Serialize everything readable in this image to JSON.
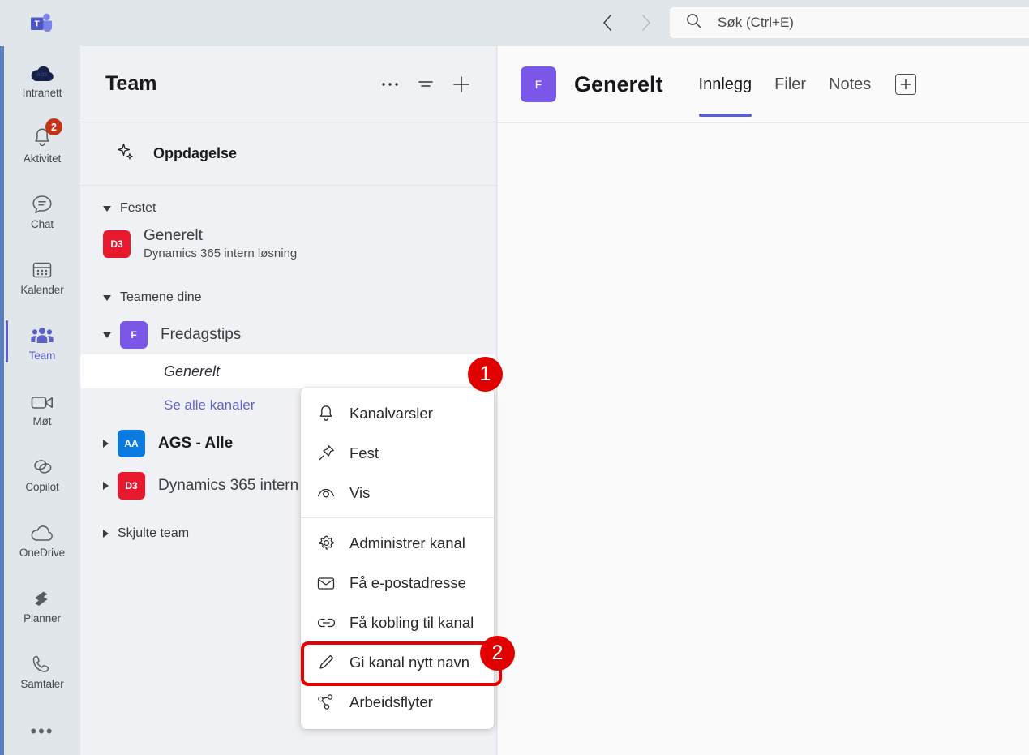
{
  "topbar": {
    "logo_name": "microsoft-teams-logo",
    "back_label": "‹",
    "forward_label": "›",
    "search_placeholder": "Søk (Ctrl+E)",
    "search_value": ""
  },
  "rail": {
    "items": [
      {
        "label": "Intranett",
        "icon": "cloud-ags-icon",
        "badge": "",
        "active": false
      },
      {
        "label": "Aktivitet",
        "icon": "bell-icon",
        "badge": "2",
        "active": false
      },
      {
        "label": "Chat",
        "icon": "chat-bubble-icon",
        "badge": "",
        "active": false
      },
      {
        "label": "Kalender",
        "icon": "calendar-icon",
        "badge": "",
        "active": false
      },
      {
        "label": "Team",
        "icon": "people-icon",
        "badge": "",
        "active": true
      },
      {
        "label": "Møt",
        "icon": "video-camera-icon",
        "badge": "",
        "active": false
      },
      {
        "label": "Copilot",
        "icon": "copilot-icon",
        "badge": "",
        "active": false
      },
      {
        "label": "OneDrive",
        "icon": "cloud-icon",
        "badge": "",
        "active": false
      },
      {
        "label": "Planner",
        "icon": "planner-icon",
        "badge": "",
        "active": false
      },
      {
        "label": "Samtaler",
        "icon": "phone-icon",
        "badge": "",
        "active": false
      }
    ],
    "more_label": "•••"
  },
  "teampanel": {
    "title": "Team",
    "header_icons": [
      "more-options-icon",
      "filter-icon",
      "add-icon"
    ],
    "discovery": {
      "label": "Oppdagelse",
      "icon": "sparkle-icon"
    },
    "pinned_group": {
      "label": "Festet",
      "items": [
        {
          "name": "Generelt",
          "subtitle": "Dynamics 365 intern løsning",
          "avatar_text": "D3",
          "avatar_color": "#e8192c"
        }
      ]
    },
    "teams_group": {
      "label": "Teamene dine",
      "expanded_team": {
        "name": "Fredagstips",
        "avatar_text": "F",
        "avatar_color": "#7b57e8",
        "channels": [
          {
            "name": "Generelt",
            "selected": true
          }
        ],
        "see_all_label": "Se alle kanaler"
      },
      "collapsed_teams": [
        {
          "name": "AGS - Alle",
          "avatar_text": "AA",
          "avatar_color": "#0a7ae0",
          "bold": true
        },
        {
          "name": "Dynamics 365 intern",
          "avatar_text": "D3",
          "avatar_color": "#e8192c",
          "bold": false
        }
      ]
    },
    "hidden_group": {
      "label": "Skjulte team"
    }
  },
  "main": {
    "avatar_text": "F",
    "avatar_color": "#7b57e8",
    "channel_title": "Generelt",
    "tabs": [
      {
        "label": "Innlegg",
        "active": true
      },
      {
        "label": "Filer",
        "active": false
      },
      {
        "label": "Notes",
        "active": false
      }
    ],
    "add_tab_icon": "add-tab-icon"
  },
  "context_menu": {
    "groups": [
      {
        "items": [
          {
            "label": "Kanalvarsler",
            "icon": "bell-icon"
          },
          {
            "label": "Fest",
            "icon": "pin-icon"
          },
          {
            "label": "Vis",
            "icon": "eye-icon"
          }
        ]
      },
      {
        "items": [
          {
            "label": "Administrer kanal",
            "icon": "gear-icon"
          },
          {
            "label": "Få e-postadresse",
            "icon": "envelope-icon"
          },
          {
            "label": "Få kobling til kanal",
            "icon": "link-icon"
          },
          {
            "label": "Gi kanal nytt navn",
            "icon": "pencil-icon",
            "highlighted": true
          },
          {
            "label": "Arbeidsflyter",
            "icon": "workflow-icon"
          }
        ]
      }
    ]
  },
  "annotations": {
    "markers": [
      {
        "number": "1",
        "target": "channel-row-generelt"
      },
      {
        "number": "2",
        "target": "context-menu-item-rename"
      }
    ],
    "color": "#e00000"
  }
}
